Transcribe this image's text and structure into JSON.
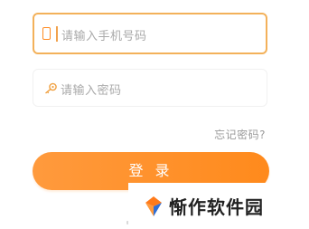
{
  "login_form": {
    "phone_placeholder": "请输入手机号码",
    "password_placeholder": "请输入密码",
    "forgot_password": "忘记密码?",
    "login_label": "登 录"
  },
  "icons": {
    "phone": "phone-icon",
    "key": "key-icon",
    "watermark_logo": "diamond-logo-icon"
  },
  "watermark": {
    "text": "惭作软件园"
  },
  "colors": {
    "accent": "#ff8a1c",
    "focus_border": "#f3b15a",
    "placeholder": "#a9a9a9",
    "button_text": "#ffffff"
  }
}
